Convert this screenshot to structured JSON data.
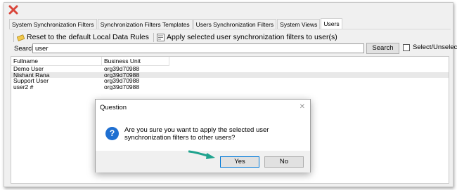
{
  "window": {
    "tabs": [
      {
        "label": "System Synchronization Filters"
      },
      {
        "label": "Synchronization Filters Templates"
      },
      {
        "label": "Users Synchronization Filters"
      },
      {
        "label": "System Views"
      },
      {
        "label": "Users"
      }
    ]
  },
  "toolbar": {
    "reset_label": "Reset to the default Local Data Rules",
    "apply_label": "Apply selected user synchronization filters to user(s)"
  },
  "search": {
    "label": "Search",
    "value": "user",
    "button_label": "Search",
    "select_all_label": "Select/Unselect all"
  },
  "grid": {
    "columns": [
      "Fullname",
      "Business Unit"
    ],
    "rows": [
      {
        "fullname": "Demo User",
        "business_unit": "org39d70988"
      },
      {
        "fullname": "Nishant Rana",
        "business_unit": "org39d70988"
      },
      {
        "fullname": "Support User",
        "business_unit": "org39d70988"
      },
      {
        "fullname": "user2 #",
        "business_unit": "org39d70988"
      }
    ]
  },
  "dialog": {
    "title": "Question",
    "message": "Are you sure you want to apply the selected user synchronization filters to other users?",
    "yes_label": "Yes",
    "no_label": "No"
  },
  "colors": {
    "close_x": "#d9453a",
    "question_icon": "#1f6fd1",
    "arrow": "#1fa38e"
  }
}
